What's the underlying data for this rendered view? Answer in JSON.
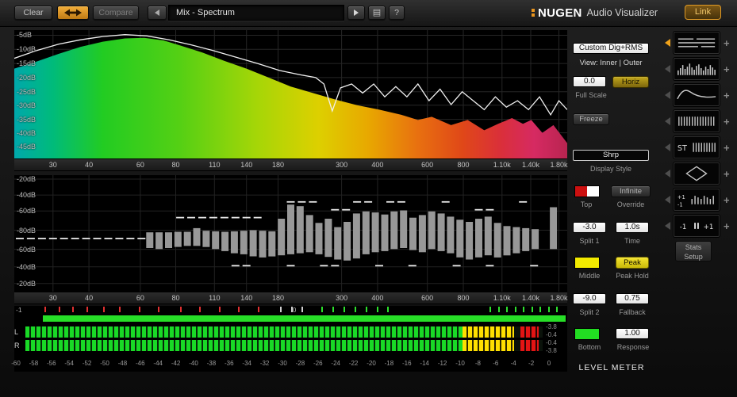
{
  "toolbar": {
    "clear": "Clear",
    "compare": "Compare",
    "preset_name": "Mix - Spectrum",
    "help": "?",
    "brand_name": "NUGEN",
    "brand_suffix": "Audio Visualizer",
    "link": "Link"
  },
  "spectrum": {
    "db_labels": [
      {
        "t": "-5dB",
        "y": 0.04
      },
      {
        "t": "-10dB",
        "y": 0.15
      },
      {
        "t": "-15dB",
        "y": 0.26
      },
      {
        "t": "-20dB",
        "y": 0.37
      },
      {
        "t": "-25dB",
        "y": 0.48
      },
      {
        "t": "-30dB",
        "y": 0.585
      },
      {
        "t": "-35dB",
        "y": 0.695
      },
      {
        "t": "-40dB",
        "y": 0.8
      },
      {
        "t": "-45dB",
        "y": 0.91
      }
    ]
  },
  "bars_panel": {
    "db_labels": [
      {
        "t": "-20dB",
        "y": 0.034
      },
      {
        "t": "-40dB",
        "y": 0.171
      },
      {
        "t": "-60dB",
        "y": 0.308
      },
      {
        "t": "-80dB",
        "y": 0.473
      },
      {
        "t": "-60dB",
        "y": 0.637
      },
      {
        "t": "-40dB",
        "y": 0.787
      },
      {
        "t": "-20dB",
        "y": 0.93
      }
    ]
  },
  "freq_ticks": [
    {
      "t": "30",
      "x": 0.07
    },
    {
      "t": "40",
      "x": 0.135
    },
    {
      "t": "60",
      "x": 0.228
    },
    {
      "t": "80",
      "x": 0.292
    },
    {
      "t": "110",
      "x": 0.362
    },
    {
      "t": "140",
      "x": 0.42
    },
    {
      "t": "180",
      "x": 0.477
    },
    {
      "t": "300",
      "x": 0.592
    },
    {
      "t": "400",
      "x": 0.657
    },
    {
      "t": "600",
      "x": 0.747
    },
    {
      "t": "800",
      "x": 0.812
    },
    {
      "t": "1.10k",
      "x": 0.882
    },
    {
      "t": "1.40k",
      "x": 0.934
    },
    {
      "t": "1.80k",
      "x": 0.985
    }
  ],
  "correlation": {
    "left_label": "-1",
    "center_label": "0",
    "bar_color": "#27de27",
    "ticks": [
      [
        0.055,
        "r"
      ],
      [
        0.08,
        "r"
      ],
      [
        0.105,
        "r"
      ],
      [
        0.13,
        "r"
      ],
      [
        0.16,
        "r"
      ],
      [
        0.19,
        "r"
      ],
      [
        0.225,
        "r"
      ],
      [
        0.26,
        "r"
      ],
      [
        0.3,
        "r"
      ],
      [
        0.335,
        "r"
      ],
      [
        0.37,
        "r"
      ],
      [
        0.405,
        "r"
      ],
      [
        0.44,
        "r"
      ],
      [
        0.48,
        "w"
      ],
      [
        0.5,
        "w"
      ],
      [
        0.52,
        "w"
      ],
      [
        0.555,
        "g"
      ],
      [
        0.575,
        "g"
      ],
      [
        0.595,
        "g"
      ],
      [
        0.615,
        "g"
      ],
      [
        0.635,
        "g"
      ],
      [
        0.655,
        "g"
      ],
      [
        0.675,
        "g"
      ],
      [
        0.86,
        "g"
      ],
      [
        0.875,
        "g"
      ],
      [
        0.89,
        "g"
      ],
      [
        0.905,
        "g"
      ],
      [
        0.92,
        "g"
      ],
      [
        0.935,
        "g"
      ],
      [
        0.95,
        "g"
      ],
      [
        0.965,
        "g"
      ],
      [
        0.98,
        "g"
      ]
    ]
  },
  "meters": {
    "channels": [
      "L",
      "R"
    ],
    "values": [
      "-3.8",
      "-0.4",
      "-0.4",
      "-3.8"
    ],
    "green_to": 0.845,
    "yellow_to": 0.945,
    "red_from": 0.957,
    "red_to": 0.992,
    "colors": {
      "green": "#19d926",
      "yellow": "#ffdf00",
      "red": "#e31414"
    },
    "scale": [
      "-60",
      "-58",
      "-56",
      "-54",
      "-52",
      "-50",
      "-48",
      "-46",
      "-44",
      "-42",
      "-40",
      "-38",
      "-36",
      "-34",
      "-32",
      "-30",
      "-28",
      "-26",
      "-24",
      "-22",
      "-20",
      "-18",
      "-16",
      "-14",
      "-12",
      "-10",
      "-8",
      "-6",
      "-4",
      "-2",
      "0"
    ]
  },
  "controls": {
    "mode_value": "Custom Dig+RMS",
    "view_label": "View: Inner | Outer",
    "full_scale_value": "0.0",
    "horiz_button": "Horiz",
    "full_scale_label": "Full Scale",
    "freeze_button": "Freeze",
    "display_style_value": "Shrp",
    "display_style_label": "Display Style",
    "top_label": "Top",
    "override_button": "Infinite",
    "override_label": "Override",
    "split1_value": "-3.0",
    "split1_label": "Split 1",
    "time_value": "1.0s",
    "time_label": "Time",
    "middle_label": "Middle",
    "peak_button": "Peak",
    "peak_hold_label": "Peak Hold",
    "split2_value": "-9.0",
    "split2_label": "Split 2",
    "fallback_value": "0.75",
    "fallback_label": "Fallback",
    "bottom_label": "Bottom",
    "response_value": "1.00",
    "response_label": "Response",
    "panel_title": "LEVEL METER",
    "swatch_colors": {
      "top_left": "#cc1010",
      "top_right": "#ffffff",
      "middle": "#f2ea00",
      "bottom": "#22dd22"
    }
  },
  "presets": {
    "stats_setup": "Stats Setup",
    "items": [
      {
        "id": "trend-lines",
        "icon": "lines",
        "selected": true
      },
      {
        "id": "spectrum-bars",
        "icon": "bars"
      },
      {
        "id": "spectrum-curve",
        "icon": "curve"
      },
      {
        "id": "spectrogram",
        "icon": "comb"
      },
      {
        "id": "stereo-spectrum",
        "icon": "st-comb"
      },
      {
        "id": "vectorscope",
        "icon": "diamond"
      },
      {
        "id": "loudness-meter",
        "icon": "mini-meter"
      },
      {
        "id": "correlation-meter",
        "icon": "corr-text"
      }
    ]
  },
  "chart_data": [
    {
      "type": "area",
      "title": "Spectrum analyzer (top panel)",
      "x_ticks": [
        "30",
        "40",
        "60",
        "80",
        "110",
        "140",
        "180",
        "300",
        "400",
        "600",
        "800",
        "1.10k",
        "1.40k",
        "1.80k"
      ],
      "y_ticks": [
        "-5dB",
        "-10dB",
        "-15dB",
        "-20dB",
        "-25dB",
        "-30dB",
        "-35dB",
        "-40dB",
        "-45dB"
      ],
      "gradient": [
        [
          "0%",
          "#00a8ac"
        ],
        [
          "7%",
          "#00bb7a"
        ],
        [
          "16%",
          "#22cc22"
        ],
        [
          "30%",
          "#55d014"
        ],
        [
          "44%",
          "#a6d607"
        ],
        [
          "55%",
          "#ddd000"
        ],
        [
          "64%",
          "#e8a800"
        ],
        [
          "73%",
          "#e87010"
        ],
        [
          "81%",
          "#e04818"
        ],
        [
          "88%",
          "#da2f3a"
        ],
        [
          "94%",
          "#d62a62"
        ],
        [
          "100%",
          "#b82450"
        ]
      ],
      "area_points": [
        [
          0,
          0.3
        ],
        [
          0.04,
          0.245
        ],
        [
          0.08,
          0.185
        ],
        [
          0.12,
          0.13
        ],
        [
          0.16,
          0.09
        ],
        [
          0.2,
          0.065
        ],
        [
          0.235,
          0.06
        ],
        [
          0.27,
          0.08
        ],
        [
          0.3,
          0.12
        ],
        [
          0.34,
          0.175
        ],
        [
          0.38,
          0.24
        ],
        [
          0.42,
          0.3
        ],
        [
          0.46,
          0.37
        ],
        [
          0.5,
          0.44
        ],
        [
          0.54,
          0.49
        ],
        [
          0.58,
          0.54
        ],
        [
          0.62,
          0.585
        ],
        [
          0.66,
          0.62
        ],
        [
          0.7,
          0.66
        ],
        [
          0.73,
          0.7
        ],
        [
          0.755,
          0.675
        ],
        [
          0.79,
          0.74
        ],
        [
          0.82,
          0.7
        ],
        [
          0.85,
          0.78
        ],
        [
          0.875,
          0.73
        ],
        [
          0.9,
          0.685
        ],
        [
          0.92,
          0.73
        ],
        [
          0.935,
          0.7
        ],
        [
          0.955,
          0.8
        ],
        [
          0.975,
          0.74
        ],
        [
          1,
          0.88
        ]
      ],
      "line_points": [
        [
          0,
          0.22
        ],
        [
          0.04,
          0.16
        ],
        [
          0.08,
          0.11
        ],
        [
          0.12,
          0.075
        ],
        [
          0.16,
          0.05
        ],
        [
          0.2,
          0.035
        ],
        [
          0.24,
          0.045
        ],
        [
          0.28,
          0.075
        ],
        [
          0.32,
          0.115
        ],
        [
          0.36,
          0.16
        ],
        [
          0.4,
          0.21
        ],
        [
          0.44,
          0.26
        ],
        [
          0.48,
          0.315
        ],
        [
          0.52,
          0.35
        ],
        [
          0.545,
          0.37
        ],
        [
          0.56,
          0.42
        ],
        [
          0.575,
          0.63
        ],
        [
          0.59,
          0.45
        ],
        [
          0.61,
          0.42
        ],
        [
          0.63,
          0.49
        ],
        [
          0.65,
          0.42
        ],
        [
          0.67,
          0.52
        ],
        [
          0.69,
          0.44
        ],
        [
          0.71,
          0.52
        ],
        [
          0.73,
          0.42
        ],
        [
          0.75,
          0.55
        ],
        [
          0.77,
          0.46
        ],
        [
          0.79,
          0.58
        ],
        [
          0.81,
          0.48
        ],
        [
          0.83,
          0.55
        ],
        [
          0.85,
          0.62
        ],
        [
          0.87,
          0.52
        ],
        [
          0.89,
          0.6
        ],
        [
          0.91,
          0.55
        ],
        [
          0.93,
          0.62
        ],
        [
          0.95,
          0.52
        ],
        [
          0.97,
          0.66
        ],
        [
          0.985,
          0.55
        ],
        [
          1,
          0.62
        ]
      ]
    },
    {
      "type": "bar",
      "title": "Split spectrum bars (middle panel)",
      "x_ticks": [
        "30",
        "40",
        "60",
        "80",
        "110",
        "140",
        "180",
        "300",
        "400",
        "600",
        "800",
        "1.10k",
        "1.40k",
        "1.80k"
      ],
      "y_ticks": [
        "-20dB",
        "-40dB",
        "-60dB",
        "-80dB",
        "-60dB",
        "-40dB",
        "-20dB"
      ],
      "bars": [
        [
          0.245,
          0.02,
          0.28
        ],
        [
          0.262,
          0.02,
          0.3
        ],
        [
          0.279,
          0.02,
          0.28
        ],
        [
          0.296,
          0.03,
          0.26
        ],
        [
          0.313,
          0.03,
          0.24
        ],
        [
          0.33,
          0.1,
          0.24
        ],
        [
          0.347,
          0.05,
          0.26
        ],
        [
          0.364,
          0.04,
          0.3
        ],
        [
          0.381,
          0.03,
          0.34
        ],
        [
          0.398,
          0.04,
          0.38
        ],
        [
          0.415,
          0.05,
          0.4
        ],
        [
          0.432,
          0.06,
          0.44
        ],
        [
          0.449,
          0.05,
          0.46
        ],
        [
          0.466,
          0.04,
          0.44
        ],
        [
          0.483,
          0.28,
          0.42
        ],
        [
          0.5,
          0.55,
          0.4
        ],
        [
          0.517,
          0.52,
          0.38
        ],
        [
          0.534,
          0.35,
          0.36
        ],
        [
          0.551,
          0.2,
          0.4
        ],
        [
          0.568,
          0.28,
          0.45
        ],
        [
          0.585,
          0.12,
          0.5
        ],
        [
          0.602,
          0.22,
          0.52
        ],
        [
          0.619,
          0.38,
          0.48
        ],
        [
          0.636,
          0.42,
          0.4
        ],
        [
          0.653,
          0.4,
          0.36
        ],
        [
          0.67,
          0.36,
          0.34
        ],
        [
          0.687,
          0.42,
          0.3
        ],
        [
          0.704,
          0.44,
          0.28
        ],
        [
          0.721,
          0.3,
          0.32
        ],
        [
          0.738,
          0.35,
          0.36
        ],
        [
          0.755,
          0.42,
          0.3
        ],
        [
          0.772,
          0.38,
          0.34
        ],
        [
          0.789,
          0.32,
          0.38
        ],
        [
          0.806,
          0.26,
          0.46
        ],
        [
          0.823,
          0.22,
          0.5
        ],
        [
          0.84,
          0.28,
          0.46
        ],
        [
          0.857,
          0.32,
          0.42
        ],
        [
          0.874,
          0.2,
          0.46
        ],
        [
          0.891,
          0.14,
          0.42
        ],
        [
          0.908,
          0.12,
          0.38
        ],
        [
          0.925,
          0.1,
          0.34
        ],
        [
          0.942,
          0.08,
          0.3
        ],
        [
          0.975,
          0.5,
          0.3
        ]
      ],
      "peak_ticks": [
        [
          0.01,
          0.1
        ],
        [
          0.03,
          0.1
        ],
        [
          0.05,
          0.1
        ],
        [
          0.07,
          0.1
        ],
        [
          0.09,
          0.1
        ],
        [
          0.11,
          0.1
        ],
        [
          0.13,
          0.1
        ],
        [
          0.15,
          0.1
        ],
        [
          0.17,
          0.1
        ],
        [
          0.19,
          0.1
        ],
        [
          0.21,
          0.1
        ],
        [
          0.23,
          0.1
        ],
        [
          0.3,
          -0.3
        ],
        [
          0.32,
          -0.3
        ],
        [
          0.34,
          -0.3
        ],
        [
          0.36,
          -0.3
        ],
        [
          0.38,
          -0.3
        ],
        [
          0.4,
          -0.3
        ],
        [
          0.42,
          -0.3
        ],
        [
          0.44,
          -0.3
        ],
        [
          0.5,
          -0.6
        ],
        [
          0.52,
          -0.6
        ],
        [
          0.54,
          -0.6
        ],
        [
          0.62,
          -0.6
        ],
        [
          0.64,
          -0.6
        ],
        [
          0.68,
          -0.6
        ],
        [
          0.7,
          -0.6
        ],
        [
          0.78,
          -0.6
        ],
        [
          0.92,
          -0.6
        ],
        [
          0.4,
          0.62
        ],
        [
          0.42,
          0.62
        ],
        [
          0.5,
          0.62
        ],
        [
          0.56,
          0.62
        ],
        [
          0.58,
          0.62
        ],
        [
          0.66,
          0.62
        ],
        [
          0.72,
          0.62
        ],
        [
          0.8,
          0.62
        ],
        [
          0.86,
          0.62
        ],
        [
          0.94,
          0.62
        ],
        [
          0.58,
          -0.45
        ],
        [
          0.6,
          -0.45
        ],
        [
          0.84,
          -0.45
        ],
        [
          0.86,
          -0.45
        ]
      ]
    }
  ]
}
